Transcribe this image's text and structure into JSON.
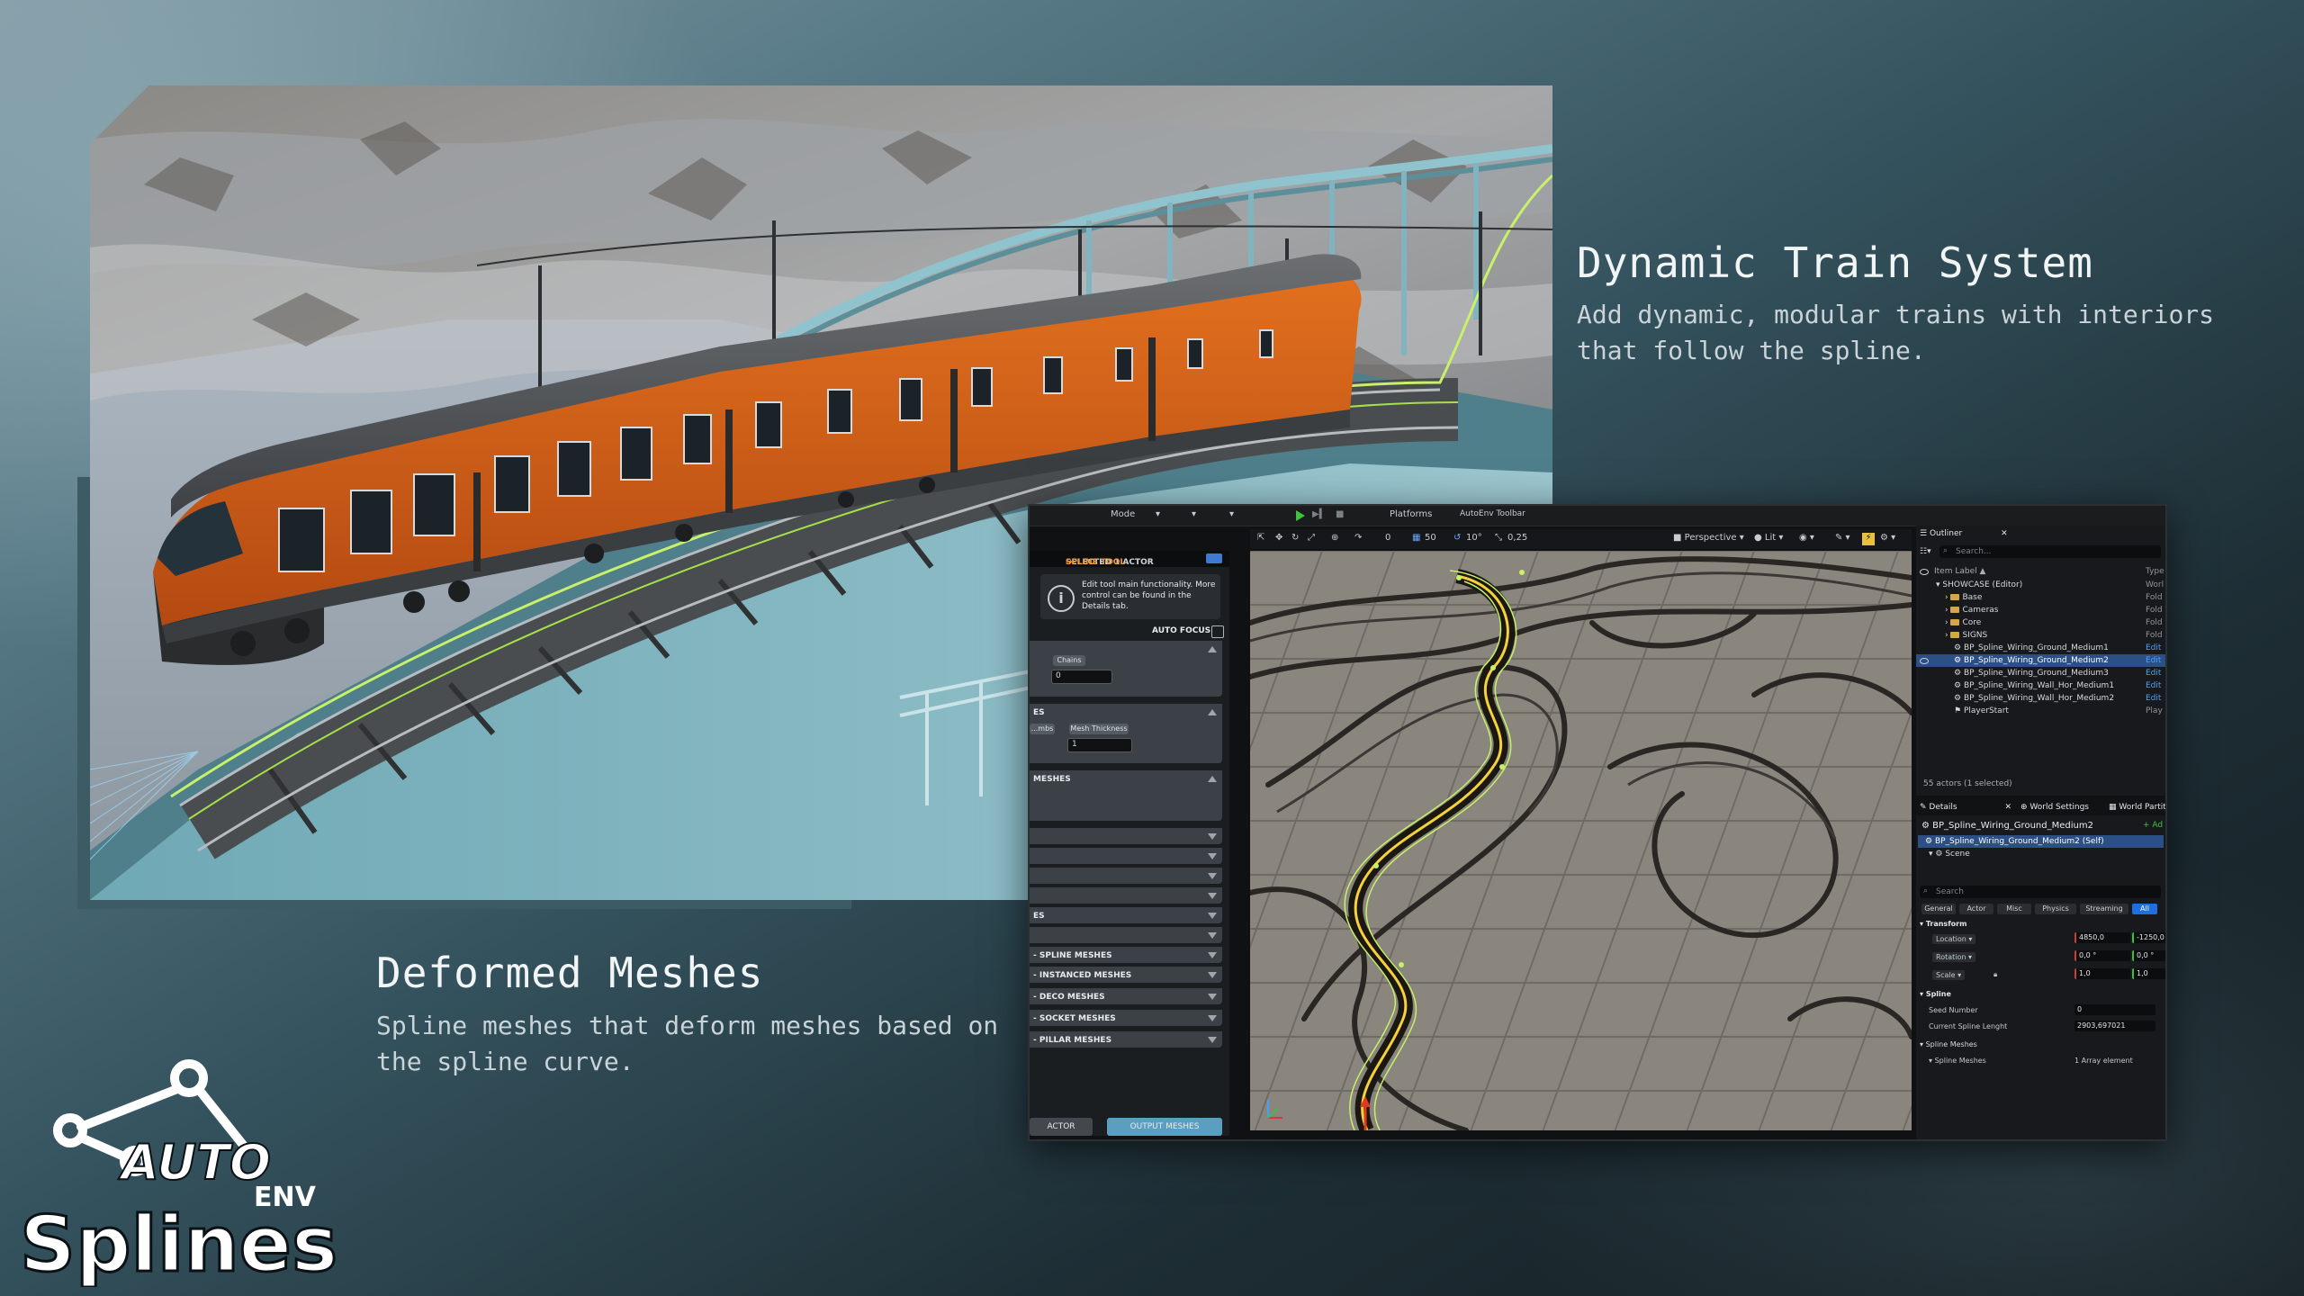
{
  "headline_train": {
    "title": "Dynamic Train System",
    "description": "Add dynamic, modular trains with interiors that follow the spline."
  },
  "headline_deformed": {
    "title": "Deformed Meshes",
    "description": "Spline meshes that deform meshes based on the spline curve."
  },
  "logo": {
    "line1": "AUTO",
    "line2": "ENV",
    "line3": "Splines"
  },
  "editor": {
    "menubar": {
      "mode": "Mode",
      "platforms": "Platforms",
      "toolbar": "AutoEnv Toolbar"
    },
    "viewport_toolbar": {
      "perspective": "Perspective",
      "lit": "Lit",
      "grid_snap": "50",
      "rotation_snap": "10°",
      "scale_snap": "0,25",
      "angle_value": "0"
    },
    "tool_panel": {
      "header_prefix": "SELECTED 1 ACTOR",
      "header_arrow": "→",
      "header_tool": "SPLINE TOOL",
      "info_text": "Edit tool main functionality. More control can be found in the Details tab.",
      "auto_focus": "AUTO FOCUS",
      "field_chip_1": "Chains",
      "field_value_1": "0",
      "section_es": "ES",
      "field_chip_2": "...mbs",
      "field_chip_3": "Mesh Thickness",
      "field_value_3": "1",
      "section_meshes": "MESHES",
      "section_es2": "ES",
      "sections": [
        "- SPLINE MESHES",
        "- INSTANCED MESHES",
        "- DECO MESHES",
        "- SOCKET MESHES",
        "- PILLAR MESHES"
      ],
      "btn_actor": "ACTOR",
      "btn_output": "OUTPUT MESHES"
    },
    "outliner": {
      "tab": "Outliner",
      "search_placeholder": "Search...",
      "col_label": "Item Label ▲",
      "col_type": "Type",
      "rows": [
        {
          "name": "SHOWCASE (Editor)",
          "type": "Worl"
        },
        {
          "name": "Base",
          "type": "Fold"
        },
        {
          "name": "Cameras",
          "type": "Fold"
        },
        {
          "name": "Core",
          "type": "Fold"
        },
        {
          "name": "SIGNS",
          "type": "Fold"
        },
        {
          "name": "BP_Spline_Wiring_Ground_Medium1",
          "type": "Edit"
        },
        {
          "name": "BP_Spline_Wiring_Ground_Medium2",
          "type": "Edit"
        },
        {
          "name": "BP_Spline_Wiring_Ground_Medium3",
          "type": "Edit"
        },
        {
          "name": "BP_Spline_Wiring_Wall_Hor_Medium1",
          "type": "Edit"
        },
        {
          "name": "BP_Spline_Wiring_Wall_Hor_Medium2",
          "type": "Edit"
        },
        {
          "name": "PlayerStart",
          "type": "Play"
        }
      ],
      "status": "55 actors (1 selected)"
    },
    "details": {
      "tab_details": "Details",
      "tab_world": "World Settings",
      "tab_partition": "World Partitio",
      "actor_name": "BP_Spline_Wiring_Ground_Medium2",
      "add_label": "+ Ad",
      "self_row": "BP_Spline_Wiring_Ground_Medium2 (Self)",
      "scene_row": "Scene",
      "search_placeholder": "Search",
      "filters": [
        "General",
        "Actor",
        "Misc",
        "Physics",
        "Streaming",
        "All"
      ],
      "section_transform": "Transform",
      "location_label": "Location",
      "location_x": "4850,0",
      "location_y": "-1250,0",
      "rotation_label": "Rotation",
      "rotation_x": "0,0 °",
      "rotation_y": "0,0 °",
      "scale_label": "Scale",
      "scale_x": "1,0",
      "scale_y": "1,0",
      "section_spline": "Spline",
      "seed_label": "Seed Number",
      "seed_value": "0",
      "length_label": "Current Spline Lenght",
      "length_value": "2903,697021",
      "section_spline_meshes": "Spline Meshes",
      "spline_meshes_label": "Spline Meshes",
      "spline_meshes_value": "1 Array element"
    }
  },
  "colors": {
    "accent_orange": "#f39a2e",
    "selection_blue": "#2c4f86",
    "spline_yellow": "#f5d23a",
    "spline_green": "#c8f06a"
  }
}
